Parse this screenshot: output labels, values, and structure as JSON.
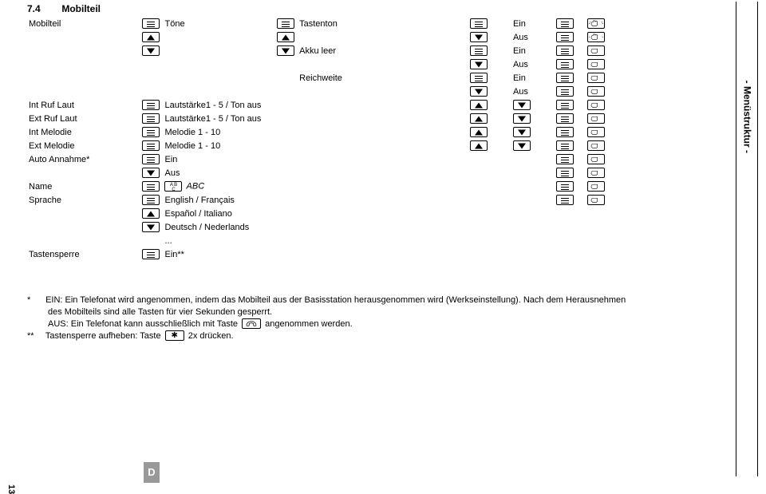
{
  "heading": {
    "number": "7.4",
    "title": "Mobilteil"
  },
  "sidebar": "- Menüstruktur -",
  "page_number": "13",
  "lang_box": "D",
  "columns": {
    "c1": [
      "Mobilteil",
      "",
      "",
      "Int Ruf Laut",
      "Ext Ruf Laut",
      "Int Melodie",
      "Ext Melodie",
      "Auto Annahme*",
      "",
      "Name",
      "Sprache",
      "",
      "",
      "",
      "Tastensperre"
    ],
    "c2": [
      "Töne",
      "",
      "",
      "",
      "",
      "",
      "",
      "",
      "",
      "",
      "",
      "",
      "",
      "",
      ""
    ],
    "c3": [
      "Tastenton",
      "",
      "Akku leer",
      "",
      "Reichweite",
      "",
      "Lautstärke1 - 5 / Ton aus",
      "Lautstärke1 - 5 / Ton aus",
      "Melodie 1 - 10",
      "Melodie 1 - 10",
      "Ein",
      "Aus",
      "ABC",
      "English / Français",
      "Español / Italiano",
      "Deutsch / Nederlands",
      "...",
      "Ein**"
    ],
    "ein_aus": [
      "Ein",
      "Aus",
      "Ein",
      "Aus",
      "Ein",
      "Aus"
    ]
  },
  "abc_label": "ABC",
  "footnotes": {
    "l1a": "EIN: Ein Telefonat wird angenommen, indem das Mobilteil aus der Basisstation herausgenommen wird (Werkseinstellung). Nach dem Herausnehmen",
    "l1b": "des Mobilteils sind alle Tasten für vier Sekunden gesperrt.",
    "l1c_pre": "AUS: Ein Telefonat kann ausschließlich mit Taste",
    "l1c_post": "angenommen werden.",
    "l2_pre": "Tastensperre aufheben: Taste",
    "l2_post": "2x drücken."
  }
}
